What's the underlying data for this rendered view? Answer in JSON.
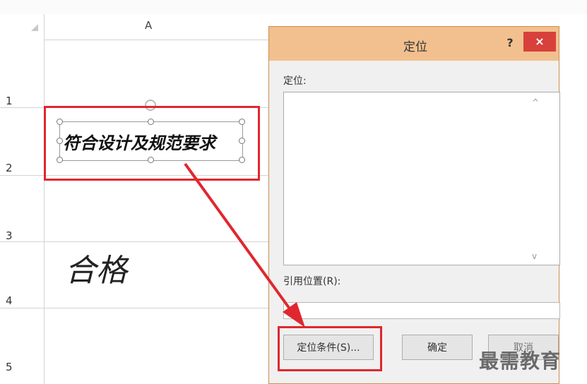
{
  "sheet": {
    "column_header": "A",
    "row_numbers": [
      "1",
      "2",
      "3",
      "4",
      "5"
    ],
    "cell_a4_handwriting": "合格"
  },
  "signature": {
    "text": "符合设计及规范要求"
  },
  "dialog": {
    "title": "定位",
    "help_label": "?",
    "close_label": "×",
    "goto_label": "定位:",
    "reference_label": "引用位置(R):",
    "special_button": "定位条件(S)...",
    "ok_button": "确定",
    "cancel_button": "取消"
  },
  "watermark": "最需教育",
  "colors": {
    "highlight": "#e0272f",
    "title_bar": "#f2c08e",
    "close": "#d8403b"
  }
}
